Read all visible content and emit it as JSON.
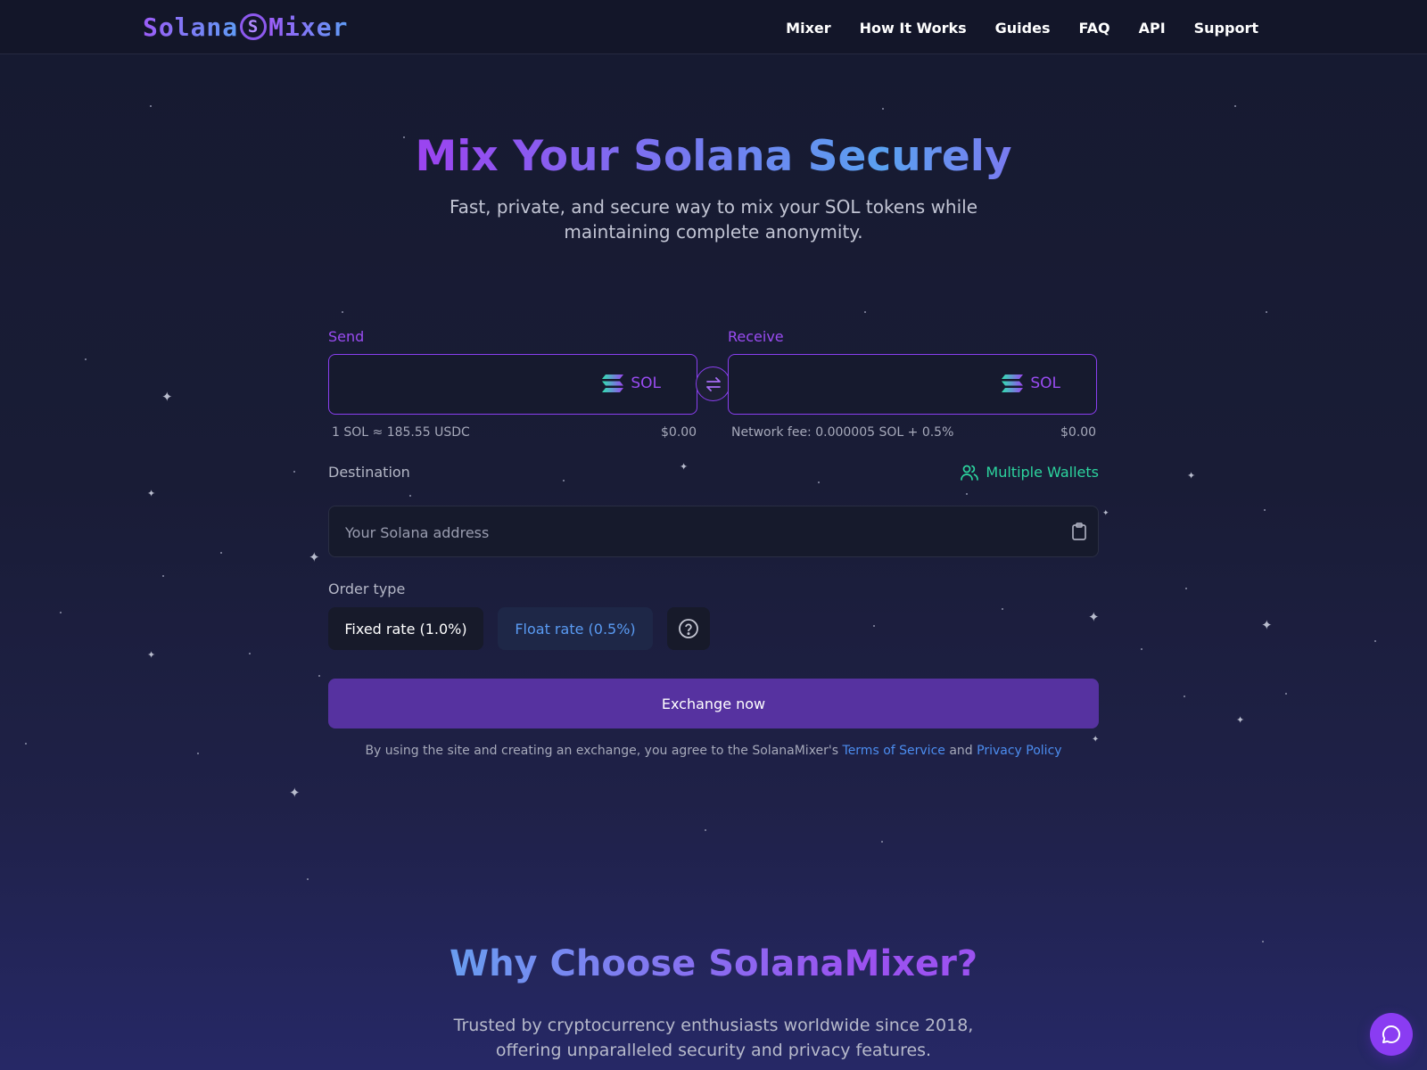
{
  "header": {
    "logo": {
      "part1": "Solana",
      "mark": "S",
      "part2": "Mixer"
    },
    "nav": [
      "Mixer",
      "How It Works",
      "Guides",
      "FAQ",
      "API",
      "Support"
    ]
  },
  "hero": {
    "title": "Mix Your Solana Securely",
    "subtitle": "Fast, private, and secure way to mix your SOL tokens while maintaining complete anonymity."
  },
  "exchange_form": {
    "send": {
      "label": "Send",
      "value": "",
      "currency": "SOL",
      "rate": "1 SOL ≈ 185.55 USDC",
      "usd": "$0.00"
    },
    "receive": {
      "label": "Receive",
      "value": "",
      "currency": "SOL",
      "fee": "Network fee: 0.000005 SOL + 0.5%",
      "usd": "$0.00"
    },
    "destination": {
      "label": "Destination",
      "placeholder": "Your Solana address",
      "value": "",
      "multiple_wallets": "Multiple Wallets"
    },
    "order_type": {
      "label": "Order type",
      "fixed": "Fixed rate (1.0%)",
      "float": "Float rate (0.5%)",
      "selected": "float"
    },
    "exchange_button": "Exchange now",
    "terms": {
      "prefix": "By using the site and creating an exchange, you agree to the SolanaMixer's ",
      "tos": "Terms of Service",
      "and": " and ",
      "privacy": "Privacy Policy"
    }
  },
  "why": {
    "title": "Why Choose SolanaMixer?",
    "subtitle": "Trusted by cryptocurrency enthusiasts worldwide since 2018, offering unparalleled security and privacy features."
  },
  "icons": {
    "send_coin": "solana-icon",
    "swap": "swap-arrows-icon",
    "multi": "users-icon",
    "paste": "clipboard-icon",
    "help": "question-circle-icon",
    "chat": "chat-bubble-icon"
  },
  "colors": {
    "accent": "#8a3ff0",
    "button": "#5632a0",
    "link": "#4c8df0",
    "green": "#2cd49e",
    "background": "#191c36"
  }
}
